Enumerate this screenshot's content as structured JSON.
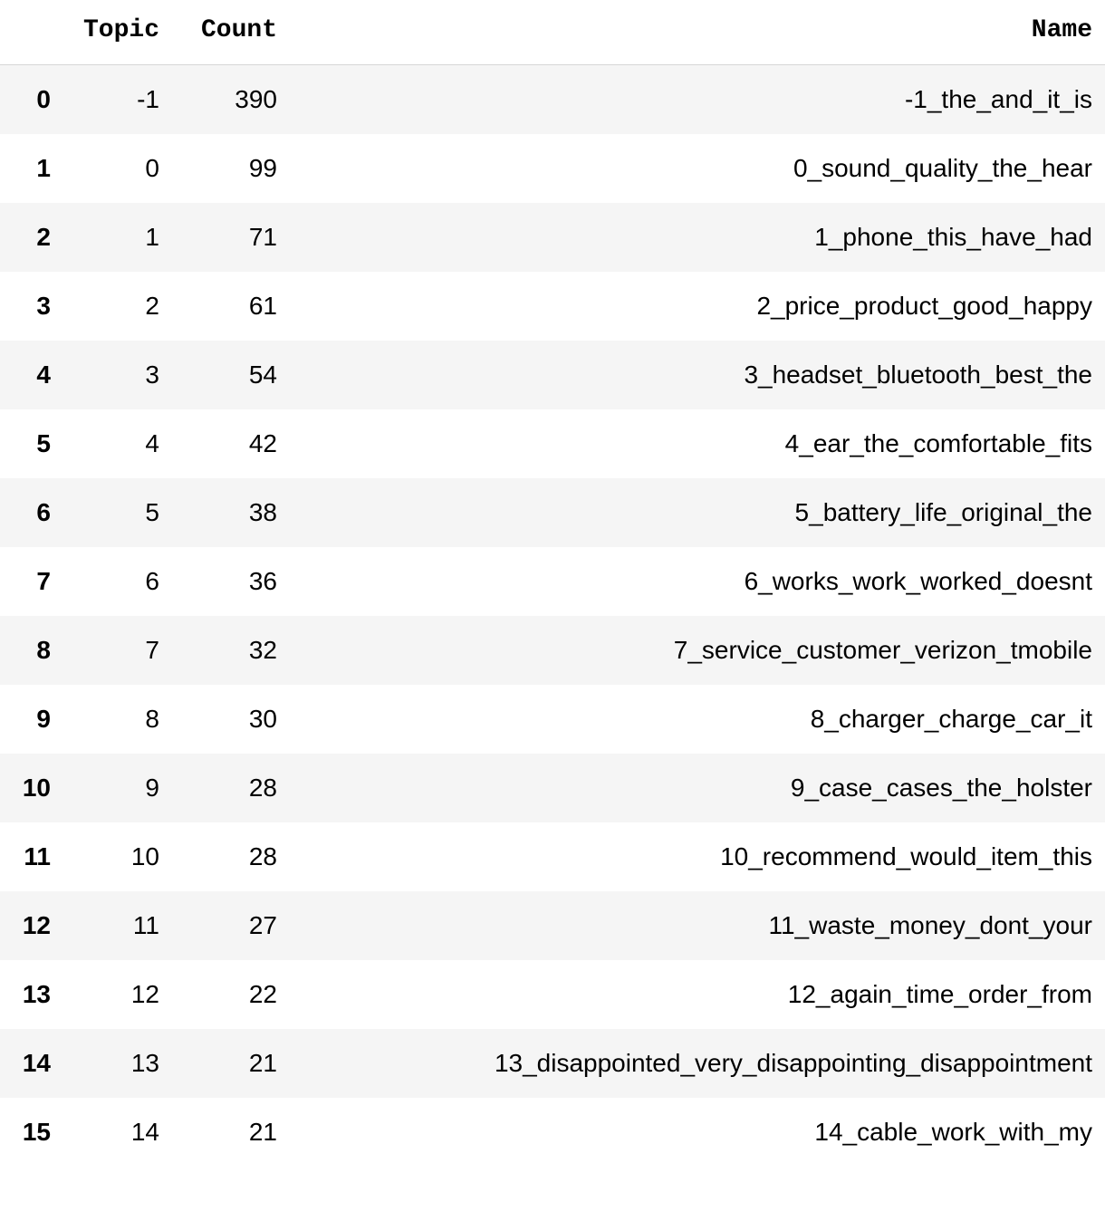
{
  "columns": {
    "index": "",
    "topic": "Topic",
    "count": "Count",
    "name": "Name"
  },
  "rows": [
    {
      "index": "0",
      "topic": "-1",
      "count": "390",
      "name": "-1_the_and_it_is"
    },
    {
      "index": "1",
      "topic": "0",
      "count": "99",
      "name": "0_sound_quality_the_hear"
    },
    {
      "index": "2",
      "topic": "1",
      "count": "71",
      "name": "1_phone_this_have_had"
    },
    {
      "index": "3",
      "topic": "2",
      "count": "61",
      "name": "2_price_product_good_happy"
    },
    {
      "index": "4",
      "topic": "3",
      "count": "54",
      "name": "3_headset_bluetooth_best_the"
    },
    {
      "index": "5",
      "topic": "4",
      "count": "42",
      "name": "4_ear_the_comfortable_fits"
    },
    {
      "index": "6",
      "topic": "5",
      "count": "38",
      "name": "5_battery_life_original_the"
    },
    {
      "index": "7",
      "topic": "6",
      "count": "36",
      "name": "6_works_work_worked_doesnt"
    },
    {
      "index": "8",
      "topic": "7",
      "count": "32",
      "name": "7_service_customer_verizon_tmobile"
    },
    {
      "index": "9",
      "topic": "8",
      "count": "30",
      "name": "8_charger_charge_car_it"
    },
    {
      "index": "10",
      "topic": "9",
      "count": "28",
      "name": "9_case_cases_the_holster"
    },
    {
      "index": "11",
      "topic": "10",
      "count": "28",
      "name": "10_recommend_would_item_this"
    },
    {
      "index": "12",
      "topic": "11",
      "count": "27",
      "name": "11_waste_money_dont_your"
    },
    {
      "index": "13",
      "topic": "12",
      "count": "22",
      "name": "12_again_time_order_from"
    },
    {
      "index": "14",
      "topic": "13",
      "count": "21",
      "name": "13_disappointed_very_disappointing_disappointment"
    },
    {
      "index": "15",
      "topic": "14",
      "count": "21",
      "name": "14_cable_work_with_my"
    }
  ]
}
